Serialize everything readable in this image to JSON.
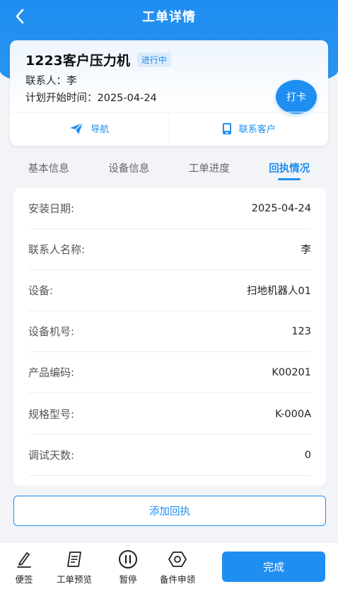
{
  "header": {
    "title": "工单详情"
  },
  "order": {
    "title": "1223客户压力机",
    "status": "进行中",
    "contact_line": "联系人：李",
    "plan_line": "计划开始时间：2025-04-24",
    "checkin_label": "打卡"
  },
  "actions": [
    {
      "label": "导航",
      "icon": "send-icon"
    },
    {
      "label": "联系客户",
      "icon": "phone-icon"
    }
  ],
  "tabs": [
    {
      "label": "基本信息",
      "active": false
    },
    {
      "label": "设备信息",
      "active": false
    },
    {
      "label": "工单进度",
      "active": false
    },
    {
      "label": "回执情况",
      "active": true
    }
  ],
  "info_rows": [
    {
      "label": "安装日期:",
      "value": "2025-04-24"
    },
    {
      "label": "联系人名称:",
      "value": "李"
    },
    {
      "label": "设备:",
      "value": "扫地机器人01"
    },
    {
      "label": "设备机号:",
      "value": "123"
    },
    {
      "label": "产品编码:",
      "value": "K00201"
    },
    {
      "label": "规格型号:",
      "value": "K-000A"
    },
    {
      "label": "调试天数:",
      "value": "0"
    }
  ],
  "add_receipt_label": "添加回执",
  "bottom_bar": {
    "items": [
      {
        "label": "便签",
        "icon": "pen-icon"
      },
      {
        "label": "工单预览",
        "icon": "document-icon"
      },
      {
        "label": "暂停",
        "icon": "pause-icon"
      },
      {
        "label": "备件申领",
        "icon": "hexagon-icon"
      }
    ],
    "complete_label": "完成"
  },
  "colors": {
    "accent": "#1f8ef1",
    "background": "#f2f4f7"
  }
}
